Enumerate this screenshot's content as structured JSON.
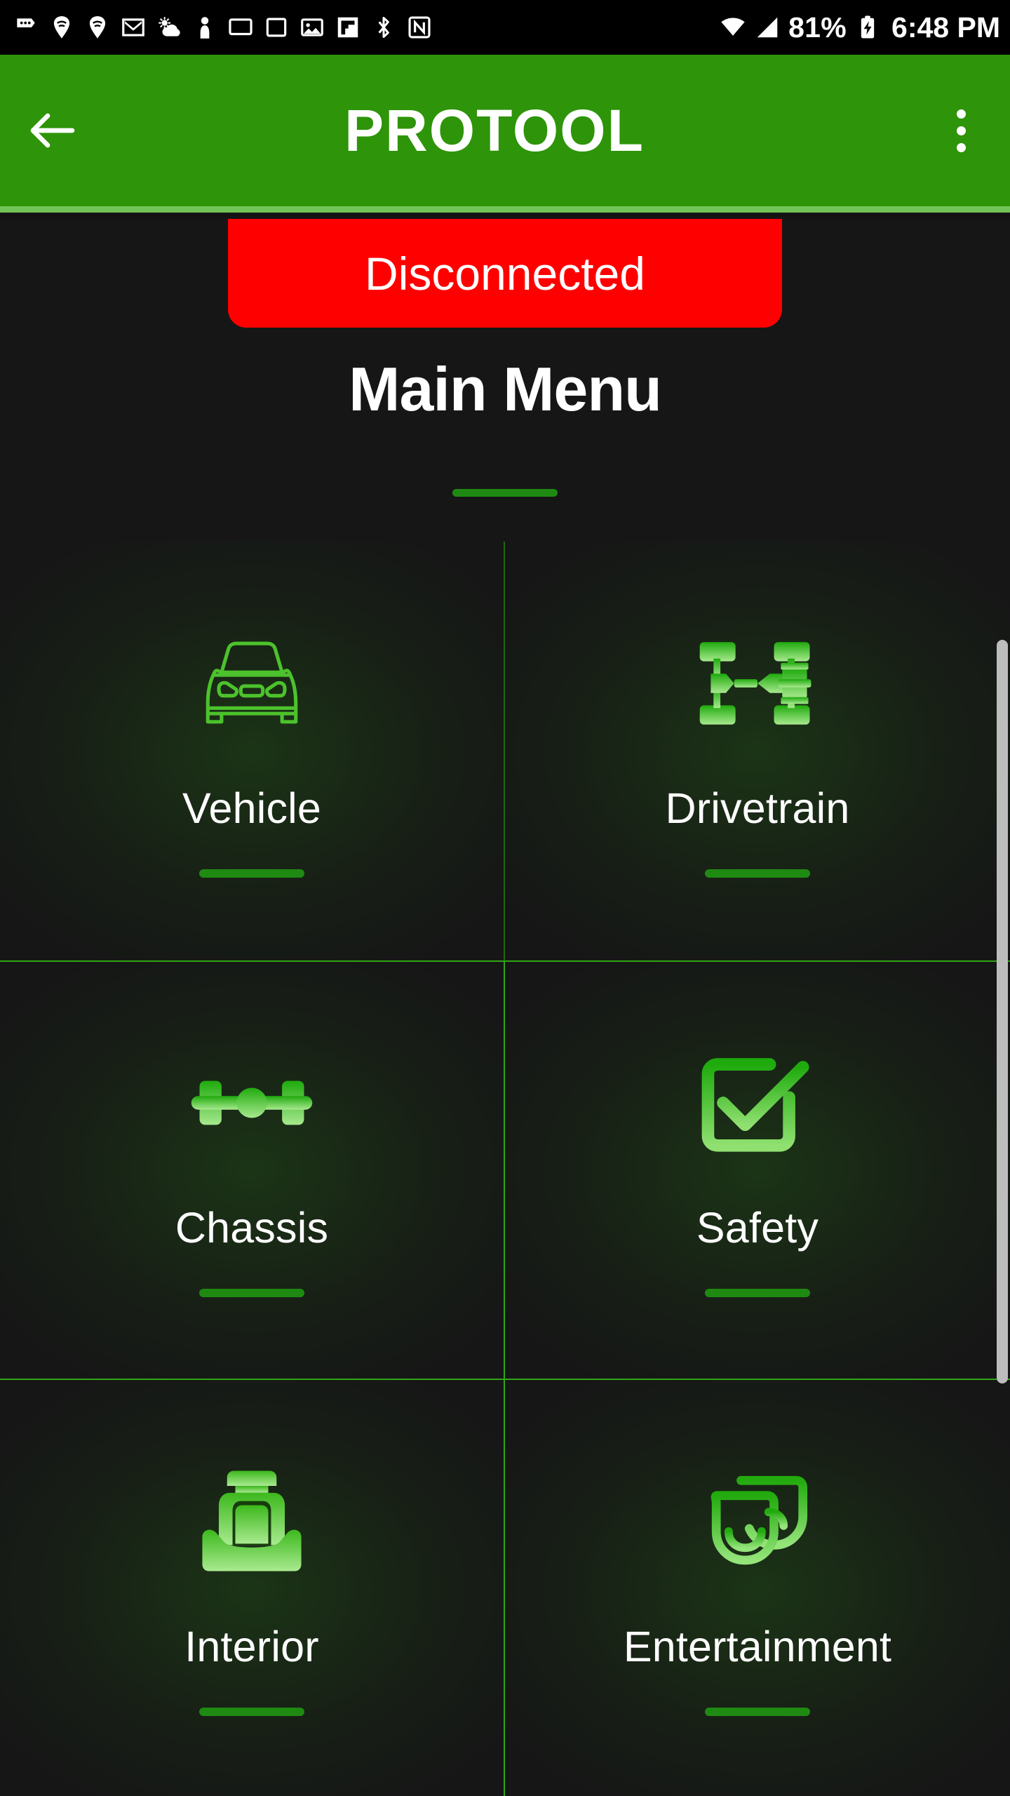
{
  "statusbar": {
    "icons_left": [
      "more-messages-icon",
      "wifi-calling-icon",
      "wifi-calling-alt-icon",
      "gmail-icon",
      "weather-partly-cloudy-icon",
      "person-icon",
      "cast-screen-icon",
      "monitor-icon",
      "photos-icon",
      "flipboard-icon",
      "bluetooth-icon",
      "nfc-icon"
    ],
    "icons_right": [
      "wifi-icon",
      "cellular-signal-icon",
      "battery-charging-icon"
    ],
    "battery_percent": "81%",
    "time": "6:48 PM"
  },
  "appbar": {
    "back_label": "back-arrow",
    "title": "PROTOOL",
    "overflow_label": "more-options",
    "background_color": "#2E9409",
    "border_color": "#72C457"
  },
  "connection": {
    "status_text": "Disconnected",
    "status_color": "#FF0000"
  },
  "page": {
    "title": "Main Menu",
    "accent_color": "#1F8A12"
  },
  "menu": {
    "tiles": [
      {
        "label": "Vehicle",
        "icon": "car-front-icon"
      },
      {
        "label": "Drivetrain",
        "icon": "drivetrain-axle-icon"
      },
      {
        "label": "Chassis",
        "icon": "chassis-axle-icon"
      },
      {
        "label": "Safety",
        "icon": "checkbox-check-icon"
      },
      {
        "label": "Interior",
        "icon": "car-seat-icon"
      },
      {
        "label": "Entertainment",
        "icon": "theater-masks-icon"
      }
    ]
  },
  "scrollbar": {
    "name": "vertical-scrollbar"
  }
}
